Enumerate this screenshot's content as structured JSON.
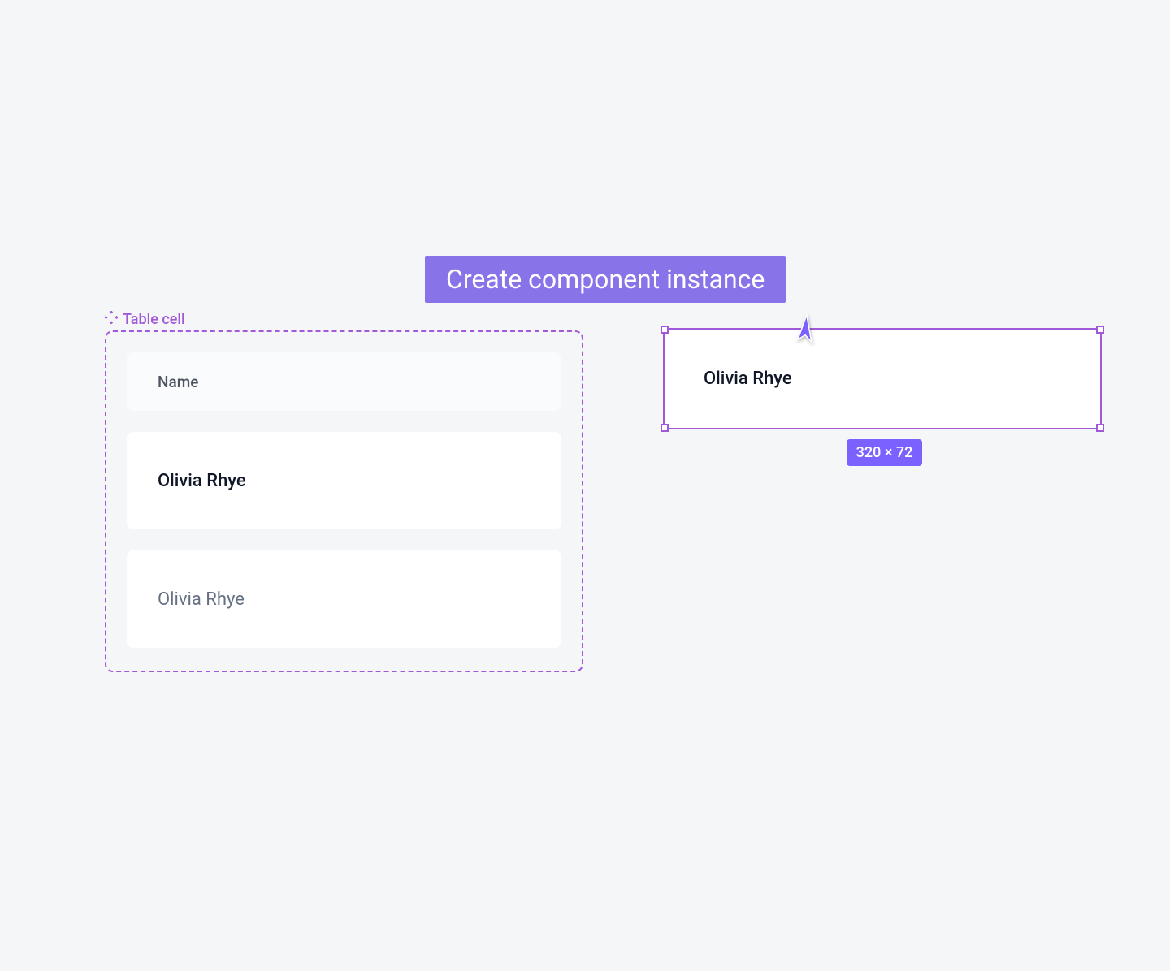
{
  "tooltip": "Create component instance",
  "component": {
    "label": "Table cell",
    "variants": {
      "header": "Name",
      "default": "Olivia Rhye",
      "muted": "Olivia Rhye"
    }
  },
  "instance": {
    "text": "Olivia Rhye",
    "dimensions": "320 × 72"
  }
}
